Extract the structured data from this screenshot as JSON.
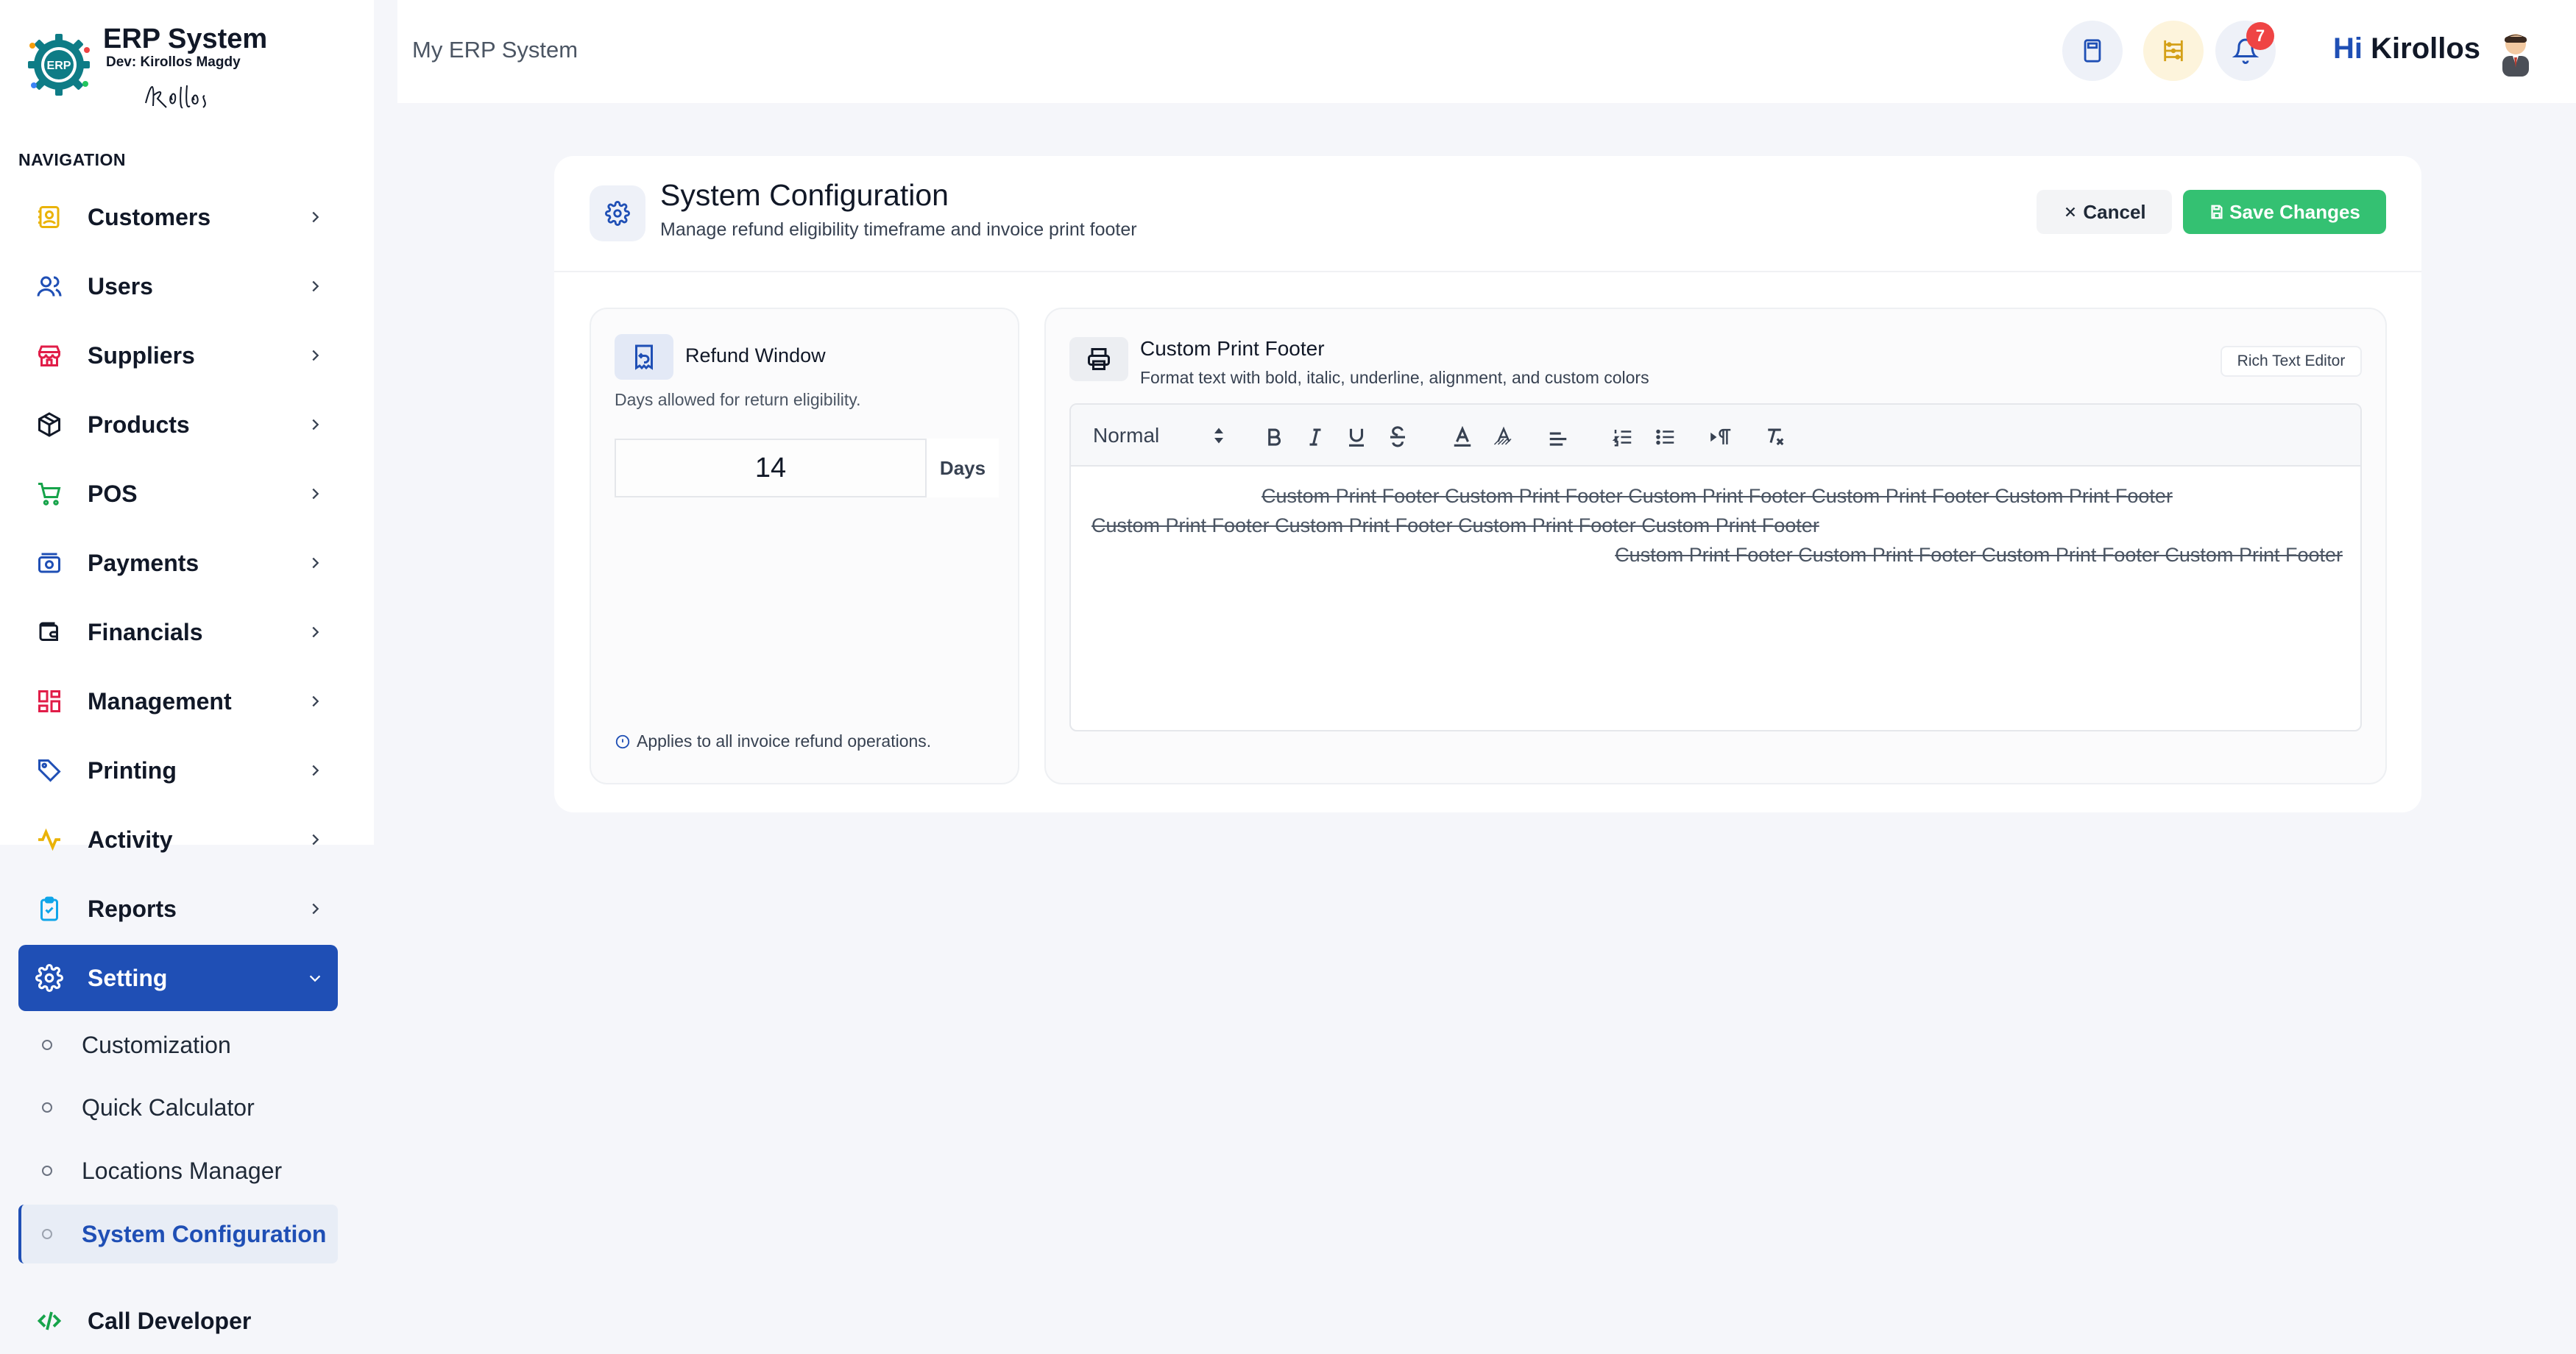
{
  "brand": {
    "title": "ERP System",
    "dev": "Dev: Kirollos Magdy",
    "logo_text": "ERP",
    "signature": "Kirollos"
  },
  "sidebar": {
    "heading": "NAVIGATION",
    "items": [
      {
        "label": "Customers",
        "icon": "customers-icon",
        "color": "#eab308"
      },
      {
        "label": "Users",
        "icon": "users-icon",
        "color": "#1f4fb5"
      },
      {
        "label": "Suppliers",
        "icon": "store-icon",
        "color": "#e11d48"
      },
      {
        "label": "Products",
        "icon": "box-icon",
        "color": "#111827"
      },
      {
        "label": "POS",
        "icon": "cart-icon",
        "color": "#16a34a"
      },
      {
        "label": "Payments",
        "icon": "payments-icon",
        "color": "#1f4fb5"
      },
      {
        "label": "Financials",
        "icon": "wallet-icon",
        "color": "#111827"
      },
      {
        "label": "Management",
        "icon": "grid-icon",
        "color": "#e11d48"
      },
      {
        "label": "Printing",
        "icon": "tag-icon",
        "color": "#1f4fb5"
      },
      {
        "label": "Activity",
        "icon": "activity-icon",
        "color": "#eab308"
      },
      {
        "label": "Reports",
        "icon": "clipboard-icon",
        "color": "#0ea5e9"
      },
      {
        "label": "Setting",
        "icon": "gear-icon",
        "color": "#ffffff"
      }
    ],
    "setting_sub": [
      {
        "label": "Customization"
      },
      {
        "label": "Quick Calculator"
      },
      {
        "label": "Locations Manager"
      },
      {
        "label": "System Configuration"
      }
    ],
    "call_developer": {
      "label": "Call Developer",
      "icon": "code-icon",
      "color": "#16a34a"
    }
  },
  "topbar": {
    "title": "My ERP System",
    "notifications_count": "7",
    "greeting_hi": "Hi",
    "greeting_name": "Kirollos"
  },
  "page": {
    "title": "System Configuration",
    "subtitle": "Manage refund eligibility timeframe and invoice print footer",
    "cancel_label": "Cancel",
    "save_label": "Save Changes"
  },
  "refund": {
    "title": "Refund Window",
    "description": "Days allowed for return eligibility.",
    "value": "14",
    "unit": "Days",
    "note": "Applies to all invoice refund operations."
  },
  "footer": {
    "title": "Custom Print Footer",
    "description": "Format text with bold, italic, underline, alignment, and custom colors",
    "badge": "Rich Text Editor",
    "format_select": "Normal",
    "lines": [
      "Custom Print Footer Custom Print Footer Custom Print Footer Custom Print Footer Custom Print Footer",
      "Custom Print Footer Custom Print Footer Custom Print Footer Custom Print Footer",
      "Custom Print Footer Custom Print Footer Custom Print Footer Custom Print Footer"
    ]
  },
  "colors": {
    "primary": "#1f4fb5",
    "success": "#34c172",
    "danger": "#ef4444"
  }
}
